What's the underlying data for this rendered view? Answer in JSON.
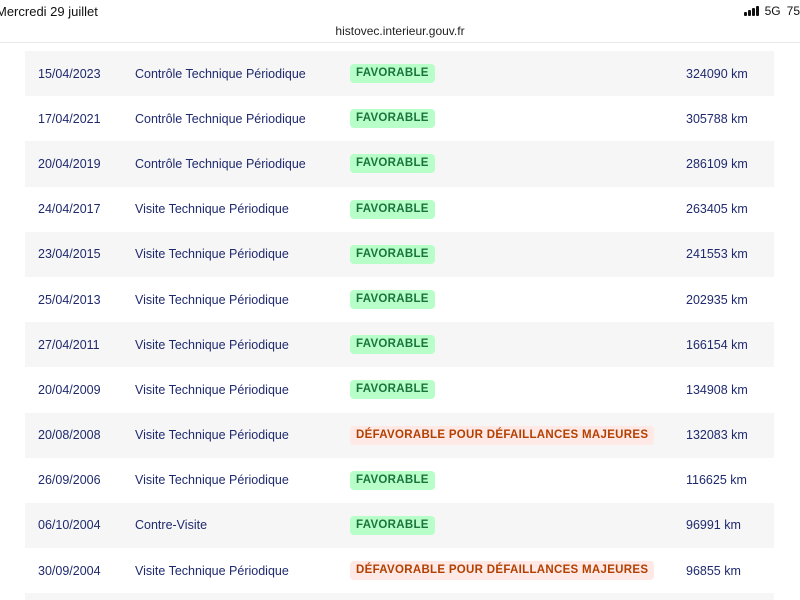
{
  "status_bar": {
    "date": "Mercredi 29 juillet",
    "network": "5G",
    "battery": "75"
  },
  "browser": {
    "url": "histovec.interieur.gouv.fr"
  },
  "rows": [
    {
      "date": "15/04/2023",
      "type": "Contrôle Technique Périodique",
      "result": "FAVORABLE",
      "status": "ok",
      "km": "324090 km"
    },
    {
      "date": "17/04/2021",
      "type": "Contrôle Technique Périodique",
      "result": "FAVORABLE",
      "status": "ok",
      "km": "305788 km"
    },
    {
      "date": "20/04/2019",
      "type": "Contrôle Technique Périodique",
      "result": "FAVORABLE",
      "status": "ok",
      "km": "286109 km"
    },
    {
      "date": "24/04/2017",
      "type": "Visite Technique Périodique",
      "result": "FAVORABLE",
      "status": "ok",
      "km": "263405 km"
    },
    {
      "date": "23/04/2015",
      "type": "Visite Technique Périodique",
      "result": "FAVORABLE",
      "status": "ok",
      "km": "241553 km"
    },
    {
      "date": "25/04/2013",
      "type": "Visite Technique Périodique",
      "result": "FAVORABLE",
      "status": "ok",
      "km": "202935 km"
    },
    {
      "date": "27/04/2011",
      "type": "Visite Technique Périodique",
      "result": "FAVORABLE",
      "status": "ok",
      "km": "166154 km"
    },
    {
      "date": "20/04/2009",
      "type": "Visite Technique Périodique",
      "result": "FAVORABLE",
      "status": "ok",
      "km": "134908 km"
    },
    {
      "date": "20/08/2008",
      "type": "Visite Technique Périodique",
      "result": "DÉFAVORABLE POUR DÉFAILLANCES MAJEURES",
      "status": "ko",
      "km": "132083 km"
    },
    {
      "date": "26/09/2006",
      "type": "Visite Technique Périodique",
      "result": "FAVORABLE",
      "status": "ok",
      "km": "116625 km"
    },
    {
      "date": "06/10/2004",
      "type": "Contre-Visite",
      "result": "FAVORABLE",
      "status": "ok",
      "km": "96991 km"
    },
    {
      "date": "30/09/2004",
      "type": "Visite Technique Périodique",
      "result": "DÉFAVORABLE POUR DÉFAILLANCES MAJEURES",
      "status": "ko",
      "km": "96855 km"
    }
  ],
  "colors": {
    "favorable_bg": "#b8fec9",
    "favorable_text": "#18753c",
    "defavorable_bg": "#ffe9e6",
    "defavorable_text": "#b34000",
    "row_text": "#1f2a6e"
  }
}
